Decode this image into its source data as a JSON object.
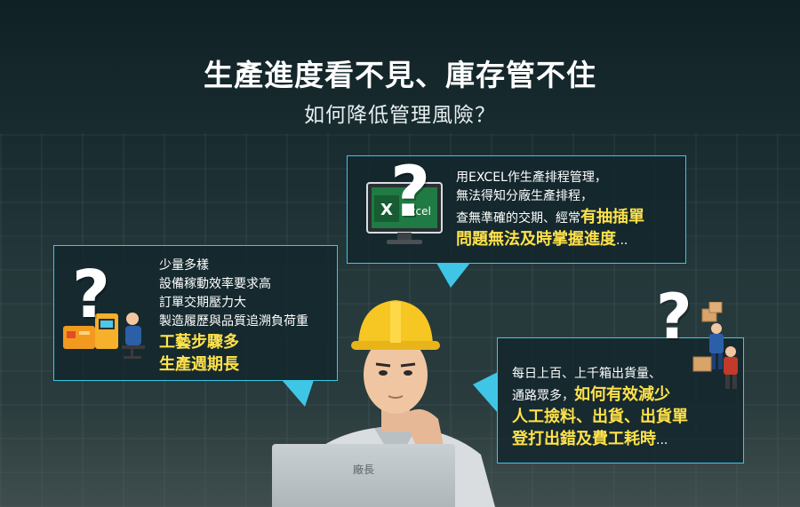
{
  "header": {
    "title": "生產進度看不見、庫存管不住",
    "subtitle": "如何降低管理風險？"
  },
  "colors": {
    "accent": "#3fc6e6",
    "highlight": "#ffe24a",
    "background": "#1e3034"
  },
  "excel_logo": {
    "text": "Excel",
    "letter": "X"
  },
  "qmark_glyph": "?",
  "bubble_excel": {
    "lines": [
      "用EXCEL作生產排程管理，",
      "無法得知分廠生產排程，",
      "查無準確的交期、經常"
    ],
    "highlight_inline": "有抽插單",
    "highlight_line": "問題無法及時掌握進度",
    "ellipsis": "..."
  },
  "bubble_production": {
    "lines": [
      "少量多樣",
      "設備稼動效率要求高",
      "訂單交期壓力大",
      "製造履歷與品質追溯負荷重"
    ],
    "highlights": [
      "工藝步驟多",
      "生產週期長"
    ]
  },
  "bubble_warehouse": {
    "lines": [
      "每日上百、上千箱出貨量、"
    ],
    "line_prefix": "通路眾多，",
    "highlight_inline": "如何有效減少",
    "highlights": [
      "人工撿料、出貨、出貨單",
      "登打出錯及費工耗時"
    ],
    "ellipsis": "..."
  },
  "laptop": {
    "label": "廠長"
  }
}
